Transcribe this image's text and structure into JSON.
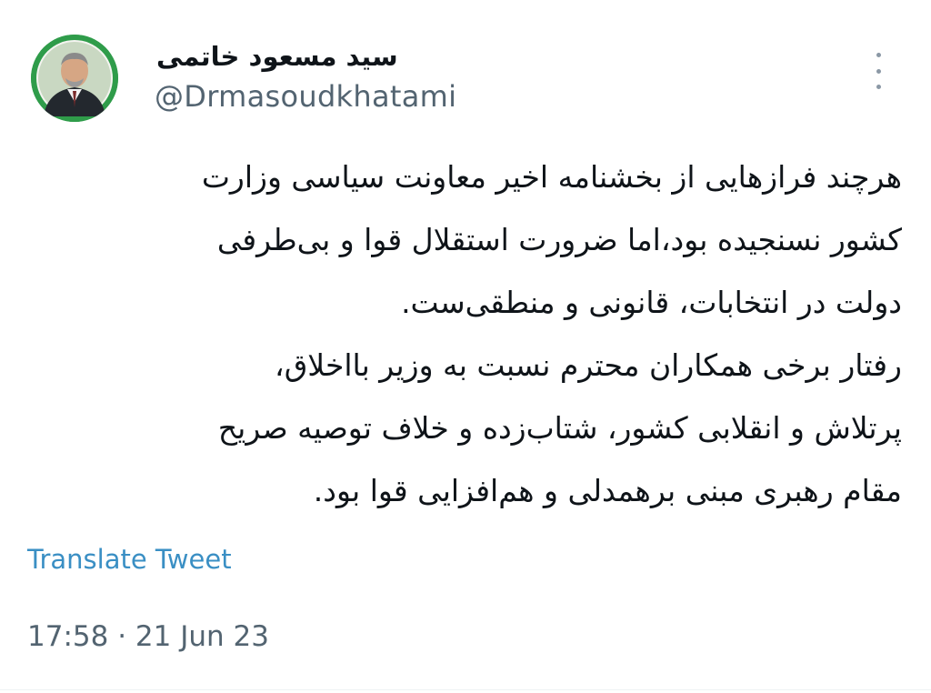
{
  "author": {
    "display_name": "سید مسعود خاتمی",
    "handle": "@Drmasoudkhatami"
  },
  "tweet": {
    "lines": [
      "هرچند فرازهایی از بخشنامه اخیر معاونت سیاسی وزارت",
      "کشور نسنجیده بود،اما ضرورت استقلال قوا و بی‌طرفی",
      "دولت در انتخابات، قانونی و منطقی‌ست.",
      "رفتار برخی همکاران محترم نسبت به وزیر بااخلاق،",
      "پرتلاش و انقلابی کشور، شتاب‌زده و خلاف توصیه صریح",
      "مقام رهبری مبنی برهمدلی و هم‌افزایی قوا بود."
    ]
  },
  "actions": {
    "translate_label": "Translate Tweet",
    "more_icon": "more-vertical-icon"
  },
  "meta": {
    "timestamp": "17:58 · 21 Jun 23"
  },
  "colors": {
    "link": "#1d9bf0",
    "secondary_text": "#536471",
    "avatar_ring": "#2e9a48"
  }
}
